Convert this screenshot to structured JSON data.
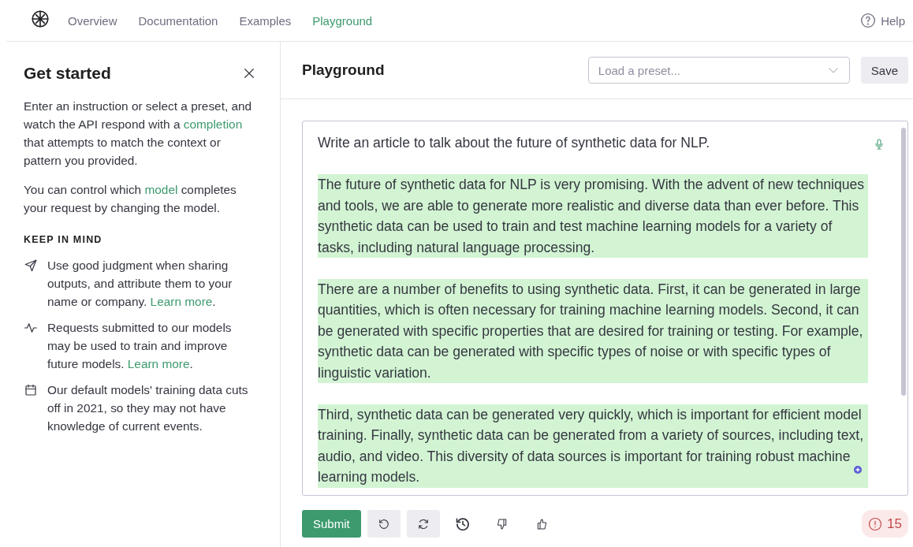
{
  "nav": {
    "items": [
      {
        "label": "Overview",
        "selected": false
      },
      {
        "label": "Documentation",
        "selected": false
      },
      {
        "label": "Examples",
        "selected": false
      },
      {
        "label": "Playground",
        "selected": true
      }
    ],
    "help": "Help"
  },
  "sidebar": {
    "title": "Get started",
    "paragraphs": [
      [
        {
          "kind": "text",
          "text": "Enter an instruction or select a preset, and watch the API respond with a "
        },
        {
          "kind": "link",
          "text": "completion"
        },
        {
          "kind": "text",
          "text": " that attempts to match the context or pattern you provided."
        }
      ],
      [
        {
          "kind": "text",
          "text": "You can control which "
        },
        {
          "kind": "link",
          "text": "model"
        },
        {
          "kind": "text",
          "text": " completes your request by changing the model."
        }
      ]
    ],
    "section_title": "KEEP IN MIND",
    "tips": [
      {
        "kind": "send",
        "parts": [
          {
            "kind": "text",
            "text": "Use good judgment when sharing outputs, and attribute them to your name or company. "
          },
          {
            "kind": "link",
            "text": "Learn more"
          },
          {
            "kind": "text",
            "text": "."
          }
        ]
      },
      {
        "kind": "pulse",
        "parts": [
          {
            "kind": "text",
            "text": "Requests submitted to our models may be used to train and improve future models. "
          },
          {
            "kind": "link",
            "text": "Learn more"
          },
          {
            "kind": "text",
            "text": "."
          }
        ]
      },
      {
        "kind": "calendar",
        "parts": [
          {
            "kind": "text",
            "text": "Our default models' training data cuts off in 2021, so they may not have knowledge of current events."
          }
        ]
      }
    ]
  },
  "main": {
    "title": "Playground",
    "preset": {
      "placeholder": "Load a preset..."
    },
    "save": "Save",
    "editor": {
      "prompt": "Write an article to talk about the future of synthetic data for NLP.",
      "completion": [
        "The future of synthetic data for NLP is very promising. With the advent of new techniques and tools, we are able to generate more realistic and diverse data than ever before. This synthetic data can be used to train and test machine learning models for a variety of tasks, including natural language processing.",
        "There are a number of benefits to using synthetic data. First, it can be generated in large quantities, which is often necessary for training machine learning models. Second, it can be generated with specific properties that are desired for training or testing. For example, synthetic data can be generated with specific types of noise or with specific types of linguistic variation.",
        "Third, synthetic data can be generated very quickly, which is important for efficient model training. Finally, synthetic data can be generated from a variety of sources, including text, audio, and video. This diversity of data sources is important for training  robust machine learning models."
      ]
    },
    "submit": "Submit",
    "warning_count": "15"
  }
}
